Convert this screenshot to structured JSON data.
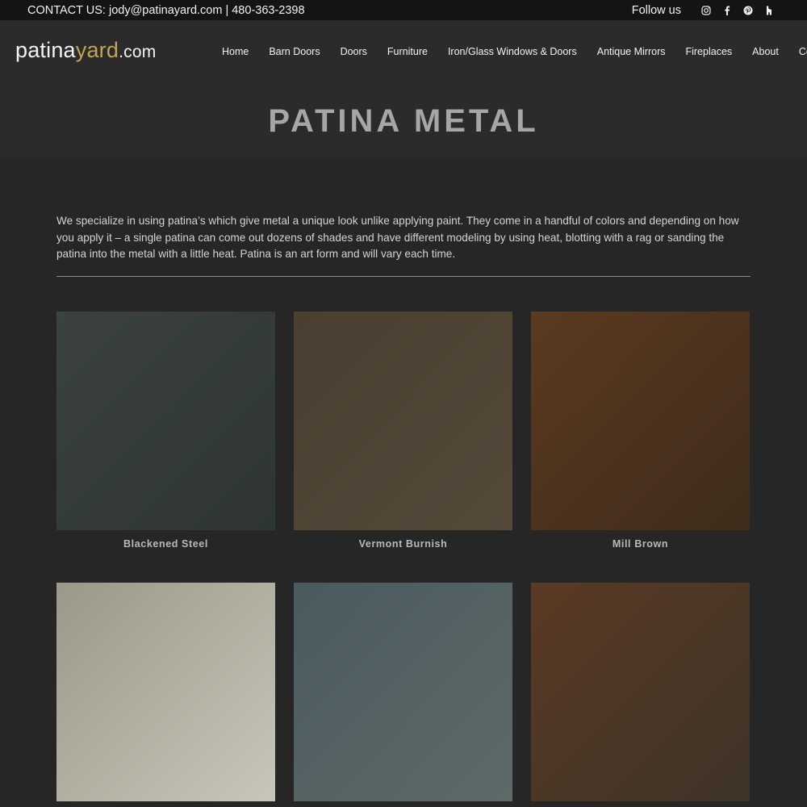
{
  "topbar": {
    "contact": "CONTACT US: jody@patinayard.com | 480-363-2398",
    "follow_label": "Follow us",
    "social": [
      {
        "name": "instagram-icon"
      },
      {
        "name": "facebook-icon"
      },
      {
        "name": "pinterest-icon"
      },
      {
        "name": "houzz-icon"
      }
    ]
  },
  "header": {
    "logo": {
      "part1": "patina",
      "part2": "yard",
      "part3": ".com"
    },
    "nav": [
      "Home",
      "Barn Doors",
      "Doors",
      "Furniture",
      "Iron/Glass Windows & Doors",
      "Antique Mirrors",
      "Fireplaces",
      "About",
      "Contact"
    ]
  },
  "page": {
    "title": "PATINA METAL",
    "intro": "We specialize in using patina’s which give metal a unique look unlike applying paint. They come in a handful of colors and depending on how you apply it – a single patina can come out dozens of shades and have different modeling by using heat, blotting with a rag or sanding the patina into the metal with a little heat. Patina is an art form and will vary each time."
  },
  "swatches": [
    {
      "label": "Blackened Steel",
      "colors": [
        "#3b4240",
        "#5a5248",
        "#2e3533",
        "#6b5a48"
      ]
    },
    {
      "label": "Vermont Burnish",
      "colors": [
        "#4a3f30",
        "#3d3428",
        "#55493a",
        "#2f2a22"
      ]
    },
    {
      "label": "Mill Brown",
      "colors": [
        "#5b3a20",
        "#7a5530",
        "#3e2c1c",
        "#8a6a40"
      ]
    },
    {
      "label": "",
      "colors": [
        "#9a9888",
        "#7b7a68",
        "#c8c6b8",
        "#5e5a4a"
      ]
    },
    {
      "label": "",
      "colors": [
        "#4a5a60",
        "#3a4852",
        "#5e6a68",
        "#2e3a42"
      ]
    },
    {
      "label": "",
      "colors": [
        "#5a3a24",
        "#7a5a40",
        "#3e3428",
        "#8a6a48"
      ]
    }
  ],
  "colors": {
    "accent": "#c5a25a",
    "background": "#262626",
    "bar": "#141414"
  }
}
